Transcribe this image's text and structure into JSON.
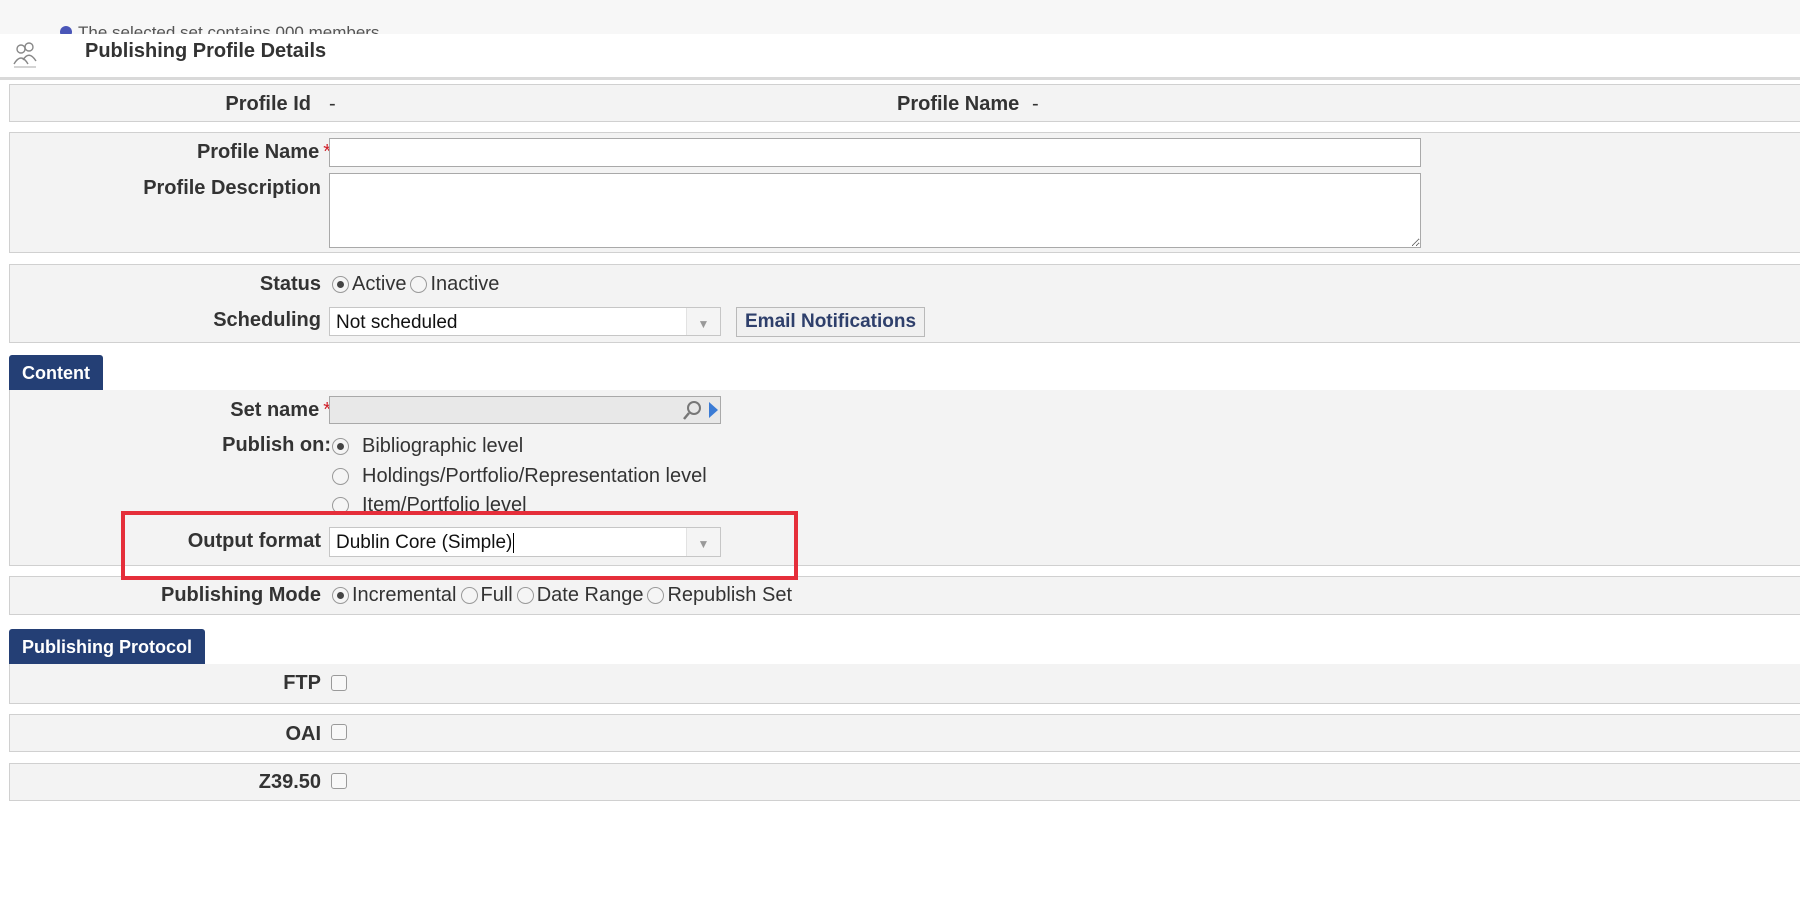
{
  "notice": {
    "text": "The selected set contains 000 members"
  },
  "header": {
    "title": "Publishing Profile Details",
    "icon": "users-icon"
  },
  "summary": {
    "profile_id_label": "Profile Id",
    "profile_id_value": "-",
    "profile_name_label": "Profile Name",
    "profile_name_value": "-"
  },
  "details": {
    "profile_name_label": "Profile Name",
    "required_mark": "*",
    "profile_name_value": "",
    "profile_description_label": "Profile Description",
    "profile_description_value": ""
  },
  "status": {
    "label": "Status",
    "options": [
      "Active",
      "Inactive"
    ],
    "selected": "Active",
    "scheduling_label": "Scheduling",
    "scheduling_value": "Not scheduled",
    "email_button": "Email Notifications"
  },
  "content": {
    "tab_label": "Content",
    "set_name_label": "Set name",
    "required_mark": "*",
    "set_name_value": "",
    "publish_on_label": "Publish on:",
    "publish_on_options": [
      "Bibliographic level",
      "Holdings/Portfolio/Representation level",
      "Item/Portfolio level"
    ],
    "publish_on_selected": "Bibliographic level",
    "output_format_label": "Output format",
    "output_format_value": "Dublin Core (Simple)"
  },
  "publishing_mode": {
    "label": "Publishing Mode",
    "options": [
      "Incremental",
      "Full",
      "Date Range",
      "Republish Set"
    ],
    "selected": "Incremental"
  },
  "protocol": {
    "tab_label": "Publishing Protocol",
    "ftp_label": "FTP",
    "oai_label": "OAI",
    "z3950_label": "Z39.50"
  },
  "colors": {
    "accent": "#243f75",
    "highlight": "#e52e3a",
    "required": "#d0202a"
  }
}
